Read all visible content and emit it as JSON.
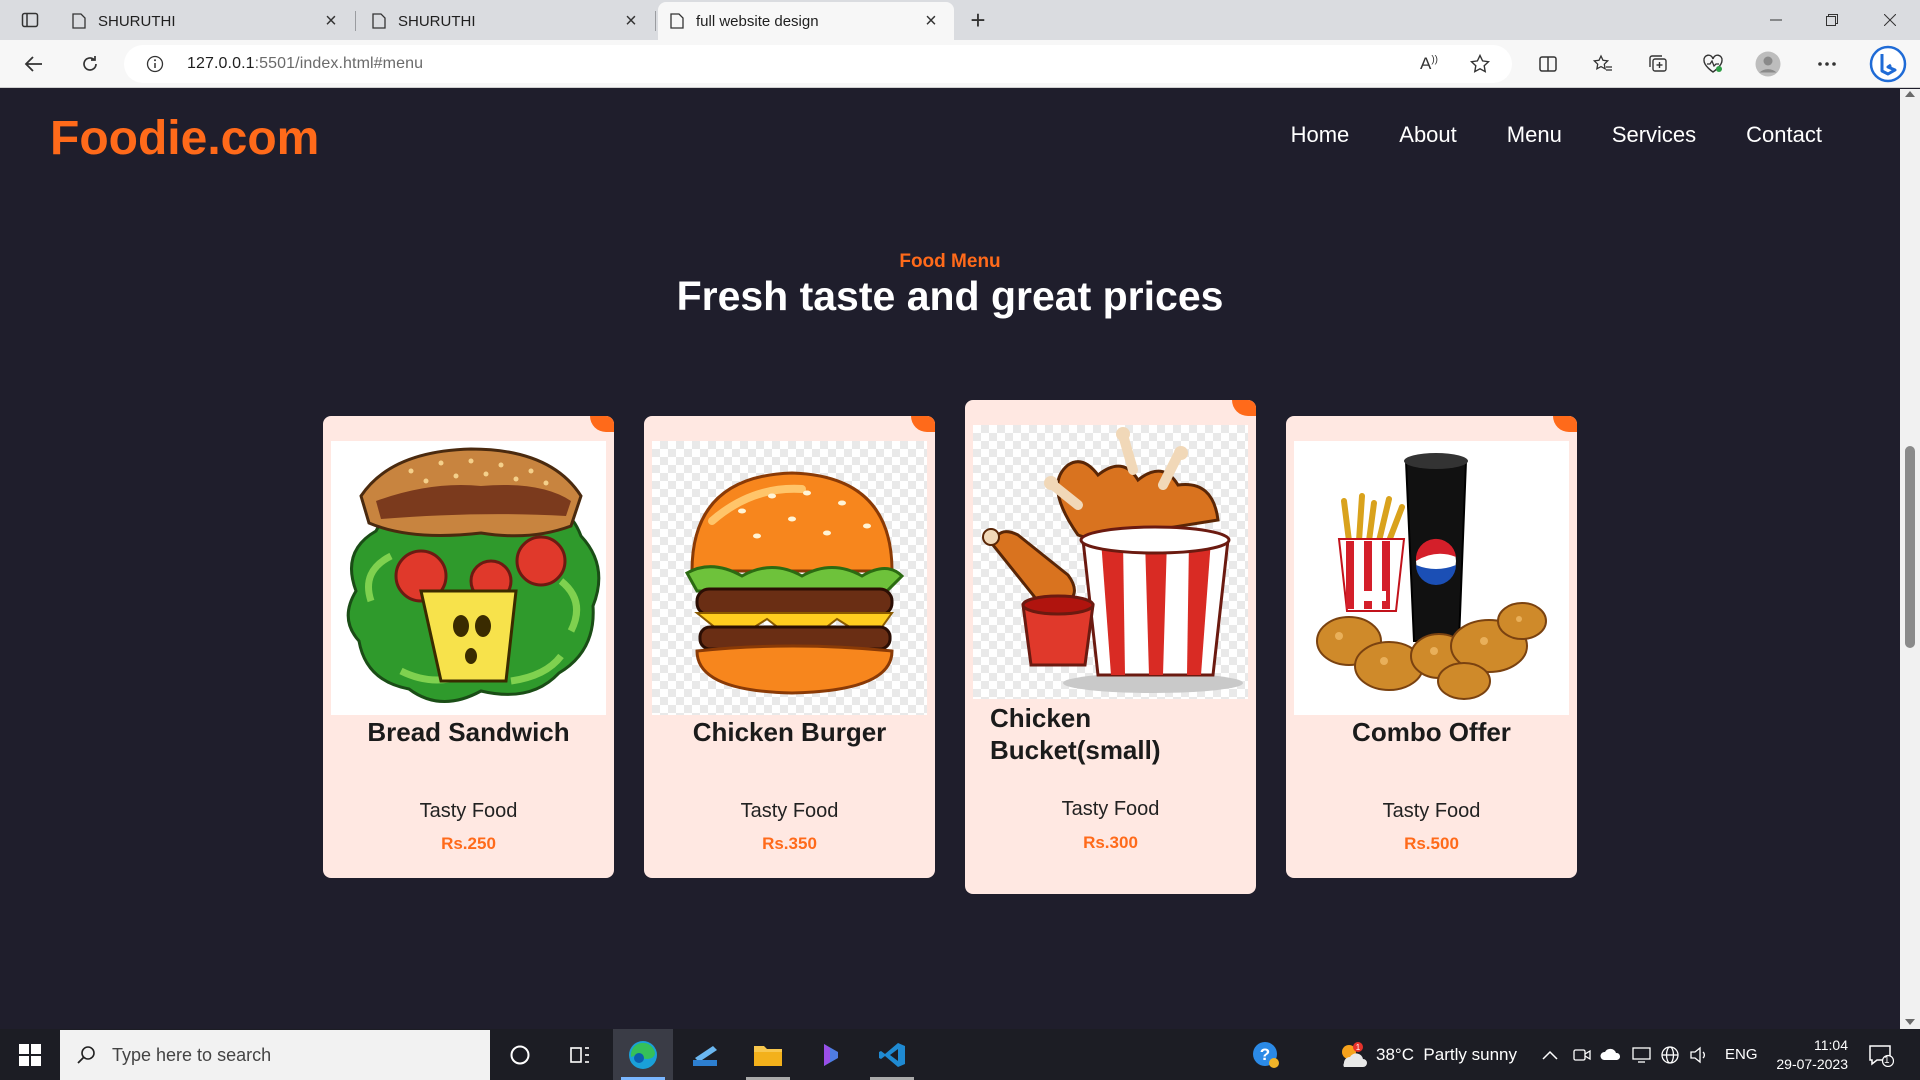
{
  "browser": {
    "tabs": [
      {
        "title": "SHURUTHI",
        "active": false
      },
      {
        "title": "SHURUTHI",
        "active": false
      },
      {
        "title": "full website design",
        "active": true
      }
    ],
    "address": {
      "host": "127.0.0.1",
      "rest": ":5501/index.html#menu"
    }
  },
  "site": {
    "logo": "Foodie.com",
    "nav": [
      "Home",
      "About",
      "Menu",
      "Services",
      "Contact"
    ],
    "section_subtitle": "Food Menu",
    "section_title": "Fresh taste and great prices",
    "cards": [
      {
        "name": "Bread Sandwich",
        "desc": "Tasty Food",
        "price": "Rs.250",
        "image": "sandwich-image"
      },
      {
        "name": "Chicken Burger",
        "desc": "Tasty Food",
        "price": "Rs.350",
        "image": "burger-image"
      },
      {
        "name": "Chicken Bucket(small)",
        "desc": "Tasty Food",
        "price": "Rs.300",
        "image": "chicken-bucket-image"
      },
      {
        "name": "Combo Offer",
        "desc": "Tasty Food",
        "price": "Rs.500",
        "image": "combo-offer-image"
      }
    ]
  },
  "taskbar": {
    "search_placeholder": "Type here to search",
    "weather": "38°C  Partly sunny",
    "language": "ENG",
    "time": "11:04",
    "date": "29-07-2023",
    "notification_count": "1"
  },
  "colors": {
    "accent": "#ff6a1a",
    "background": "#1f1e2c",
    "card": "#ffe8e2"
  }
}
